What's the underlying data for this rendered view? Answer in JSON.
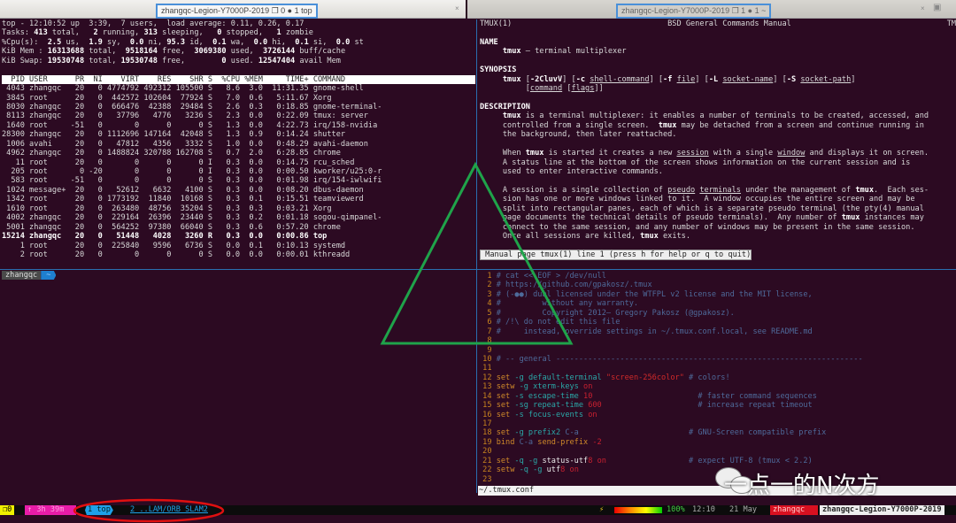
{
  "titlebar": {
    "left_title": "zhangqc-Legion-Y7000P-2019 ❐ 0 ● 1 top",
    "right_title": "zhangqc-Legion-Y7000P-2019 ❐ 1 ● 1 ~",
    "close": "×",
    "new_tab_icon": "terminal-icon"
  },
  "top_pane": {
    "lines": [
      [
        [
          "top - 12:10:52 up  3:39,  7 users,  load average: 0.11, 0.26, 0.17",
          ""
        ]
      ],
      [
        [
          "Tasks: ",
          ""
        ],
        [
          "413",
          "b"
        ],
        [
          " total,   ",
          ""
        ],
        [
          "2",
          "b"
        ],
        [
          " running, ",
          ""
        ],
        [
          "313",
          "b"
        ],
        [
          " sleeping,   ",
          ""
        ],
        [
          "0",
          "b"
        ],
        [
          " stopped,   ",
          ""
        ],
        [
          "1",
          "b"
        ],
        [
          " zombie",
          ""
        ]
      ],
      [
        [
          "%Cpu(s):  ",
          ""
        ],
        [
          "2.5",
          "b"
        ],
        [
          " us,  ",
          ""
        ],
        [
          "1.9",
          "b"
        ],
        [
          " sy,  ",
          ""
        ],
        [
          "0.0",
          "b"
        ],
        [
          " ni, ",
          ""
        ],
        [
          "95.3",
          "b"
        ],
        [
          " id,  ",
          ""
        ],
        [
          "0.1",
          "b"
        ],
        [
          " wa,  ",
          ""
        ],
        [
          "0.0",
          "b"
        ],
        [
          " hi,  ",
          ""
        ],
        [
          "0.1",
          "b"
        ],
        [
          " si,  ",
          ""
        ],
        [
          "0.0",
          "b"
        ],
        [
          " st",
          ""
        ]
      ],
      [
        [
          "KiB Mem : ",
          ""
        ],
        [
          "16313688",
          "b"
        ],
        [
          " total,  ",
          ""
        ],
        [
          "9518164",
          "b"
        ],
        [
          " free,  ",
          ""
        ],
        [
          "3069380",
          "b"
        ],
        [
          " used,  ",
          ""
        ],
        [
          "3726144",
          "b"
        ],
        [
          " buff/cache",
          ""
        ]
      ],
      [
        [
          "KiB Swap: ",
          ""
        ],
        [
          "19530748",
          "b"
        ],
        [
          " total, ",
          ""
        ],
        [
          "19530748",
          "b"
        ],
        [
          " free,        ",
          ""
        ],
        [
          "0",
          "b"
        ],
        [
          " used. ",
          ""
        ],
        [
          "12547404",
          "b"
        ],
        [
          " avail Mem",
          ""
        ]
      ],
      [
        [
          "",
          ""
        ]
      ],
      [
        [
          "  PID USER      PR  NI    VIRT    RES    SHR S  %CPU %MEM     TIME+ COMMAND     ",
          "hdr"
        ]
      ],
      [
        [
          " 4043 zhangqc   20   0 4774792 492312 105500 S   8.6  3.0  11:31.35 gnome-shell",
          ""
        ]
      ],
      [
        [
          " 3845 root      20   0  442572 102604  77924 S   7.0  0.6   5:11.67 Xorg",
          ""
        ]
      ],
      [
        [
          " 8030 zhangqc   20   0  666476  42388  29484 S   2.6  0.3   0:18.85 gnome-terminal-",
          ""
        ]
      ],
      [
        [
          " 8113 zhangqc   20   0   37796   4776   3236 S   2.3  0.0   0:22.09 tmux: server",
          ""
        ]
      ],
      [
        [
          " 1640 root     -51   0       0      0      0 S   1.3  0.0   4:22.73 irq/158-nvidia",
          ""
        ]
      ],
      [
        [
          "28300 zhangqc   20   0 1112696 147164  42048 S   1.3  0.9   0:14.24 shutter",
          ""
        ]
      ],
      [
        [
          " 1006 avahi     20   0   47812   4356   3332 S   1.0  0.0   0:48.29 avahi-daemon",
          ""
        ]
      ],
      [
        [
          " 4962 zhangqc   20   0 1488824 320788 162708 S   0.7  2.0   6:28.85 chrome",
          ""
        ]
      ],
      [
        [
          "   11 root      20   0       0      0      0 I   0.3  0.0   0:14.75 rcu_sched",
          ""
        ]
      ],
      [
        [
          "  205 root       0 -20       0      0      0 I   0.3  0.0   0:00.50 kworker/u25:0-r",
          ""
        ]
      ],
      [
        [
          "  583 root     -51   0       0      0      0 S   0.3  0.0   0:01.98 irq/154-iwlwifi",
          ""
        ]
      ],
      [
        [
          " 1024 message+  20   0   52612   6632   4100 S   0.3  0.0   0:08.20 dbus-daemon",
          ""
        ]
      ],
      [
        [
          " 1342 root      20   0 1773192  11840  10168 S   0.3  0.1   0:15.51 teamviewerd",
          ""
        ]
      ],
      [
        [
          " 1610 root      20   0  263480  48756  35204 S   0.3  0.3   0:03.21 Xorg",
          ""
        ]
      ],
      [
        [
          " 4002 zhangqc   20   0  229164  26396  23440 S   0.3  0.2   0:01.18 sogou-qimpanel-",
          ""
        ]
      ],
      [
        [
          " 5001 zhangqc   20   0  564252  97380  66040 S   0.3  0.6   0:57.20 chrome",
          ""
        ]
      ],
      [
        [
          "15214 zhangqc   20   0   51448   4028   3260 R   0.3  0.0   0:00.86 top",
          "b"
        ]
      ],
      [
        [
          "    1 root      20   0  225840   9596   6736 S   0.0  0.1   0:10.13 systemd",
          ""
        ]
      ],
      [
        [
          "    2 root      20   0       0      0      0 S   0.0  0.0   0:00.01 kthreadd",
          ""
        ]
      ]
    ]
  },
  "shell": {
    "user": "zhangqc",
    "dir": "~"
  },
  "man_pane": {
    "lines": [
      [
        [
          "TMUX(1)                                  BSD General Commands Manual                                  TMUX(1)",
          ""
        ]
      ],
      [
        [
          "",
          ""
        ]
      ],
      [
        [
          "NAME",
          "b"
        ]
      ],
      [
        [
          "     ",
          ""
        ],
        [
          "tmux",
          "b"
        ],
        [
          " — terminal multiplexer",
          ""
        ]
      ],
      [
        [
          "",
          ""
        ]
      ],
      [
        [
          "SYNOPSIS",
          "b"
        ]
      ],
      [
        [
          "     ",
          ""
        ],
        [
          "tmux",
          "b"
        ],
        [
          " [",
          ""
        ],
        [
          "-2CluvV",
          "b"
        ],
        [
          "] [",
          ""
        ],
        [
          "-c",
          "b"
        ],
        [
          " ",
          ""
        ],
        [
          "shell-command",
          "u"
        ],
        [
          "] [",
          ""
        ],
        [
          "-f",
          "b"
        ],
        [
          " ",
          ""
        ],
        [
          "file",
          "u"
        ],
        [
          "] [",
          ""
        ],
        [
          "-L",
          "b"
        ],
        [
          " ",
          ""
        ],
        [
          "socket-name",
          "u"
        ],
        [
          "] [",
          ""
        ],
        [
          "-S",
          "b"
        ],
        [
          " ",
          ""
        ],
        [
          "socket-path",
          "u"
        ],
        [
          "]",
          ""
        ]
      ],
      [
        [
          "          [",
          ""
        ],
        [
          "command",
          "u"
        ],
        [
          " [",
          ""
        ],
        [
          "flags",
          "u"
        ],
        [
          "]]",
          ""
        ]
      ],
      [
        [
          "",
          ""
        ]
      ],
      [
        [
          "DESCRIPTION",
          "b"
        ]
      ],
      [
        [
          "     ",
          ""
        ],
        [
          "tmux",
          "b"
        ],
        [
          " is a terminal multiplexer: it enables a number of terminals to be created, accessed, and",
          ""
        ]
      ],
      [
        [
          "     controlled from a single screen.  ",
          ""
        ],
        [
          "tmux",
          "b"
        ],
        [
          " may be detached from a screen and continue running in",
          ""
        ]
      ],
      [
        [
          "     the background, then later reattached.",
          ""
        ]
      ],
      [
        [
          "",
          ""
        ]
      ],
      [
        [
          "     When ",
          ""
        ],
        [
          "tmux",
          "b"
        ],
        [
          " is started it creates a new ",
          ""
        ],
        [
          "session",
          "u"
        ],
        [
          " with a single ",
          ""
        ],
        [
          "window",
          "u"
        ],
        [
          " and displays it on screen.",
          ""
        ]
      ],
      [
        [
          "     A status line at the bottom of the screen shows information on the current session and is",
          ""
        ]
      ],
      [
        [
          "     used to enter interactive commands.",
          ""
        ]
      ],
      [
        [
          "",
          ""
        ]
      ],
      [
        [
          "     A session is a single collection of ",
          ""
        ],
        [
          "pseudo",
          "u"
        ],
        [
          " ",
          ""
        ],
        [
          "terminals",
          "u"
        ],
        [
          " under the management of ",
          ""
        ],
        [
          "tmux",
          "b"
        ],
        [
          ".  Each ses-",
          ""
        ]
      ],
      [
        [
          "     sion has one or more windows linked to it.  A window occupies the entire screen and may be",
          ""
        ]
      ],
      [
        [
          "     split into rectangular panes, each of which is a separate pseudo terminal (the pty(4) manual",
          ""
        ]
      ],
      [
        [
          "     page documents the technical details of pseudo terminals).  Any number of ",
          ""
        ],
        [
          "tmux",
          "b"
        ],
        [
          " instances may",
          ""
        ]
      ],
      [
        [
          "     connect to the same session, and any number of windows may be present in the same session.",
          ""
        ]
      ],
      [
        [
          "     Once all sessions are killed, ",
          ""
        ],
        [
          "tmux",
          "b"
        ],
        [
          " exits.",
          ""
        ]
      ],
      [
        [
          "",
          ""
        ]
      ],
      [
        [
          "",
          ""
        ],
        [
          " Manual page tmux(1) line 1 (press h for help or q to quit)",
          "inv"
        ]
      ]
    ]
  },
  "vim_pane": {
    "lines": [
      [
        [
          "  1 ",
          "ln"
        ],
        [
          "# cat << EOF > /dev/null",
          "cm"
        ]
      ],
      [
        [
          "  2 ",
          "ln"
        ],
        [
          "# https://github.com/gpakosz/.tmux",
          "cm"
        ]
      ],
      [
        [
          "  3 ",
          "ln"
        ],
        [
          "# (‑●●) dual licensed under the WTFPL v2 license and the MIT license,",
          "cm"
        ]
      ],
      [
        [
          "  4 ",
          "ln"
        ],
        [
          "#         without any warranty.",
          "cm"
        ]
      ],
      [
        [
          "  5 ",
          "ln"
        ],
        [
          "#         Copyright 2012— Gregory Pakosz (@gpakosz).",
          "cm"
        ]
      ],
      [
        [
          "  6 ",
          "ln"
        ],
        [
          "# /!\\ do not edit this file",
          "cm"
        ]
      ],
      [
        [
          "  7 ",
          "ln"
        ],
        [
          "#     instead, override settings in ~/.tmux.conf.local, see README.md",
          "cm"
        ]
      ],
      [
        [
          "  8 ",
          "ln"
        ]
      ],
      [
        [
          "  9 ",
          "ln"
        ]
      ],
      [
        [
          " 10 ",
          "ln"
        ],
        [
          "# -- general -------------------------------------------------------------------",
          "cm"
        ]
      ],
      [
        [
          " 11 ",
          "ln"
        ]
      ],
      [
        [
          " 12 ",
          "ln"
        ],
        [
          "set",
          "kw"
        ],
        [
          " -g ",
          "op"
        ],
        [
          "default-terminal",
          "op"
        ],
        [
          " \"screen-256color\"",
          "st"
        ],
        [
          " # colors!",
          "cm"
        ]
      ],
      [
        [
          " 13 ",
          "ln"
        ],
        [
          "setw",
          "kw"
        ],
        [
          " -g xterm-keys",
          "op"
        ],
        [
          " on",
          "nm"
        ]
      ],
      [
        [
          " 14 ",
          "ln"
        ],
        [
          "set",
          "kw"
        ],
        [
          " -s escape-time",
          "op"
        ],
        [
          " 10",
          "nm"
        ],
        [
          "                       # faster command sequences",
          "cm"
        ]
      ],
      [
        [
          " 15 ",
          "ln"
        ],
        [
          "set",
          "kw"
        ],
        [
          " -sg repeat-time",
          "op"
        ],
        [
          " 600",
          "nm"
        ],
        [
          "                     # increase repeat timeout",
          "cm"
        ]
      ],
      [
        [
          " 16 ",
          "ln"
        ],
        [
          "set",
          "kw"
        ],
        [
          " -s focus-events",
          "op"
        ],
        [
          " on",
          "nm"
        ]
      ],
      [
        [
          " 17 ",
          "ln"
        ]
      ],
      [
        [
          " 18 ",
          "ln"
        ],
        [
          "set",
          "kw"
        ],
        [
          " -g prefix2",
          "op"
        ],
        [
          " C-a",
          "cm"
        ],
        [
          "                        # GNU-Screen compatible prefix",
          "cm"
        ]
      ],
      [
        [
          " 19 ",
          "ln"
        ],
        [
          "bind",
          "kw"
        ],
        [
          " C-a",
          "cm"
        ],
        [
          " send-prefix",
          "kw"
        ],
        [
          " -2",
          "nm"
        ]
      ],
      [
        [
          " 20 ",
          "ln"
        ]
      ],
      [
        [
          " 21 ",
          "ln"
        ],
        [
          "set",
          "kw"
        ],
        [
          " -q -g ",
          "op"
        ],
        [
          "status-utf",
          "wt"
        ],
        [
          "8",
          "nm"
        ],
        [
          " on",
          "nm"
        ],
        [
          "                  # expect UTF-8 (tmux < 2.2)",
          "cm"
        ]
      ],
      [
        [
          " 22 ",
          "ln"
        ],
        [
          "setw",
          "kw"
        ],
        [
          " -q -g ",
          "op"
        ],
        [
          "utf",
          "wt"
        ],
        [
          "8",
          "nm"
        ],
        [
          " on",
          "nm"
        ]
      ],
      [
        [
          " 23 ",
          "ln"
        ]
      ]
    ],
    "filename": "~/.tmux.conf"
  },
  "status_bar": {
    "pane_count": "❐0",
    "uptime": "↑ 3h 39m",
    "window_active": "1 top",
    "window_other": "2 ..LAM/ORB_SLAM2",
    "charging": "⚡",
    "battery_percent": "100%",
    "battery_level": 1.0,
    "time": "12:10",
    "date": "21 May",
    "user": "zhangqc",
    "host": "zhangqc-Legion-Y7000P-2019"
  },
  "watermark": {
    "text": "一点一的N次方"
  },
  "annotations": {
    "triangle_color": "#1fa34a",
    "ellipse_color": "#e01010",
    "box_color": "#4a90d9"
  }
}
